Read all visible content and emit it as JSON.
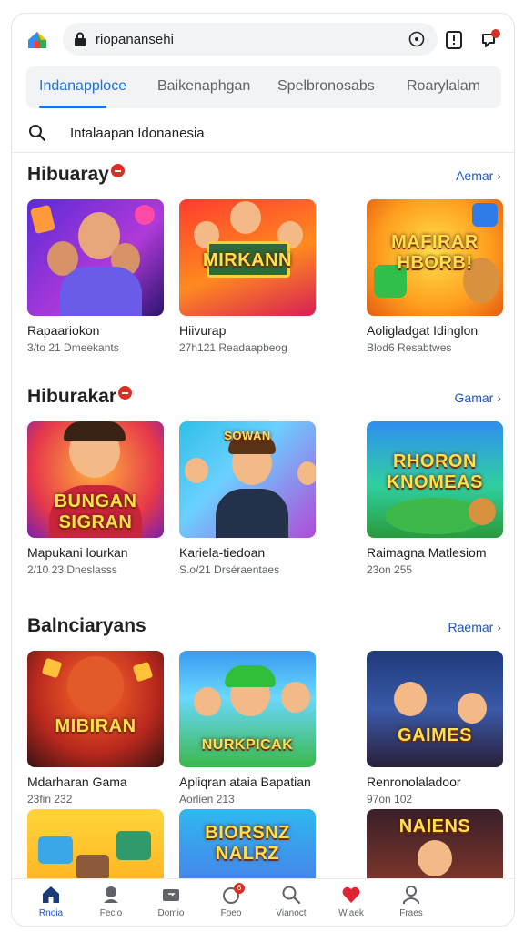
{
  "browser": {
    "url_text": "riopanansehi",
    "notification_count": "6"
  },
  "tabs": [
    {
      "label": "Indanapploce",
      "active": true
    },
    {
      "label": "Baikenaphgan",
      "active": false
    },
    {
      "label": "Spelbronosabs",
      "active": false
    },
    {
      "label": "Roarylalam",
      "active": false
    }
  ],
  "search": {
    "text": "Intalaapan Idonanesia"
  },
  "sections": [
    {
      "title": "Hibuaray",
      "link": "Aemar",
      "cards": [
        {
          "name": "Rapaariokon",
          "meta": "3/to 21 Dmeekants",
          "thumb_text": ""
        },
        {
          "name": "Hiivurap",
          "meta": "27h121 Readaapbeog",
          "thumb_text": "MIRKANN"
        },
        {
          "name": "Aoligladgat Idinglon",
          "meta": "Blod6 Resabtwes",
          "thumb_text": "MAFIRAR HBORB!"
        }
      ]
    },
    {
      "title": "Hiburakar",
      "link": "Gamar",
      "cards": [
        {
          "name": "Mapukani lourkan",
          "meta": "2/10 23 Dneslasss",
          "thumb_text": "BUNGAN SIGRAN"
        },
        {
          "name": "Kariela-tiedoan",
          "meta": "S.o/21 Drséraentaes",
          "thumb_text": "SOWAN"
        },
        {
          "name": "Raimagna Matlesiom",
          "meta": "23on 255",
          "thumb_text": "RHORON KNOMEAS"
        }
      ]
    },
    {
      "title": "Balnciaryans",
      "link": "Raemar",
      "cards": [
        {
          "name": "Mdarharan Gama",
          "meta": "23fin 232",
          "thumb_text": "MIBIRAN"
        },
        {
          "name": "Apliqran ataia Bapatian",
          "meta": "Aorlien 213",
          "thumb_text": "NURKPICAK"
        },
        {
          "name": "Renronolaladoor",
          "meta": "97on 102",
          "thumb_text": "GAIMES"
        }
      ]
    },
    {
      "title": "",
      "link": "",
      "cards": [
        {
          "name": "",
          "meta": "",
          "thumb_text": ""
        },
        {
          "name": "",
          "meta": "",
          "thumb_text": "BIORSNZ NALRZ"
        },
        {
          "name": "",
          "meta": "",
          "thumb_text": "NAIENS"
        }
      ]
    }
  ],
  "bottom_nav": [
    {
      "label": "Rnoia",
      "icon": "home-icon",
      "active": true
    },
    {
      "label": "Fecio",
      "icon": "person-icon",
      "active": false
    },
    {
      "label": "Domio",
      "icon": "tablet-icon",
      "active": false
    },
    {
      "label": "Foeo",
      "icon": "notifications-icon",
      "active": false,
      "badge": "6"
    },
    {
      "label": "Vianoct",
      "icon": "search-icon",
      "active": false
    },
    {
      "label": "Wiaek",
      "icon": "heart-icon",
      "active": false
    },
    {
      "label": "Fraes",
      "icon": "account-icon",
      "active": false
    }
  ],
  "colors": {
    "accent": "#1a73e8",
    "badge": "#d93025"
  }
}
